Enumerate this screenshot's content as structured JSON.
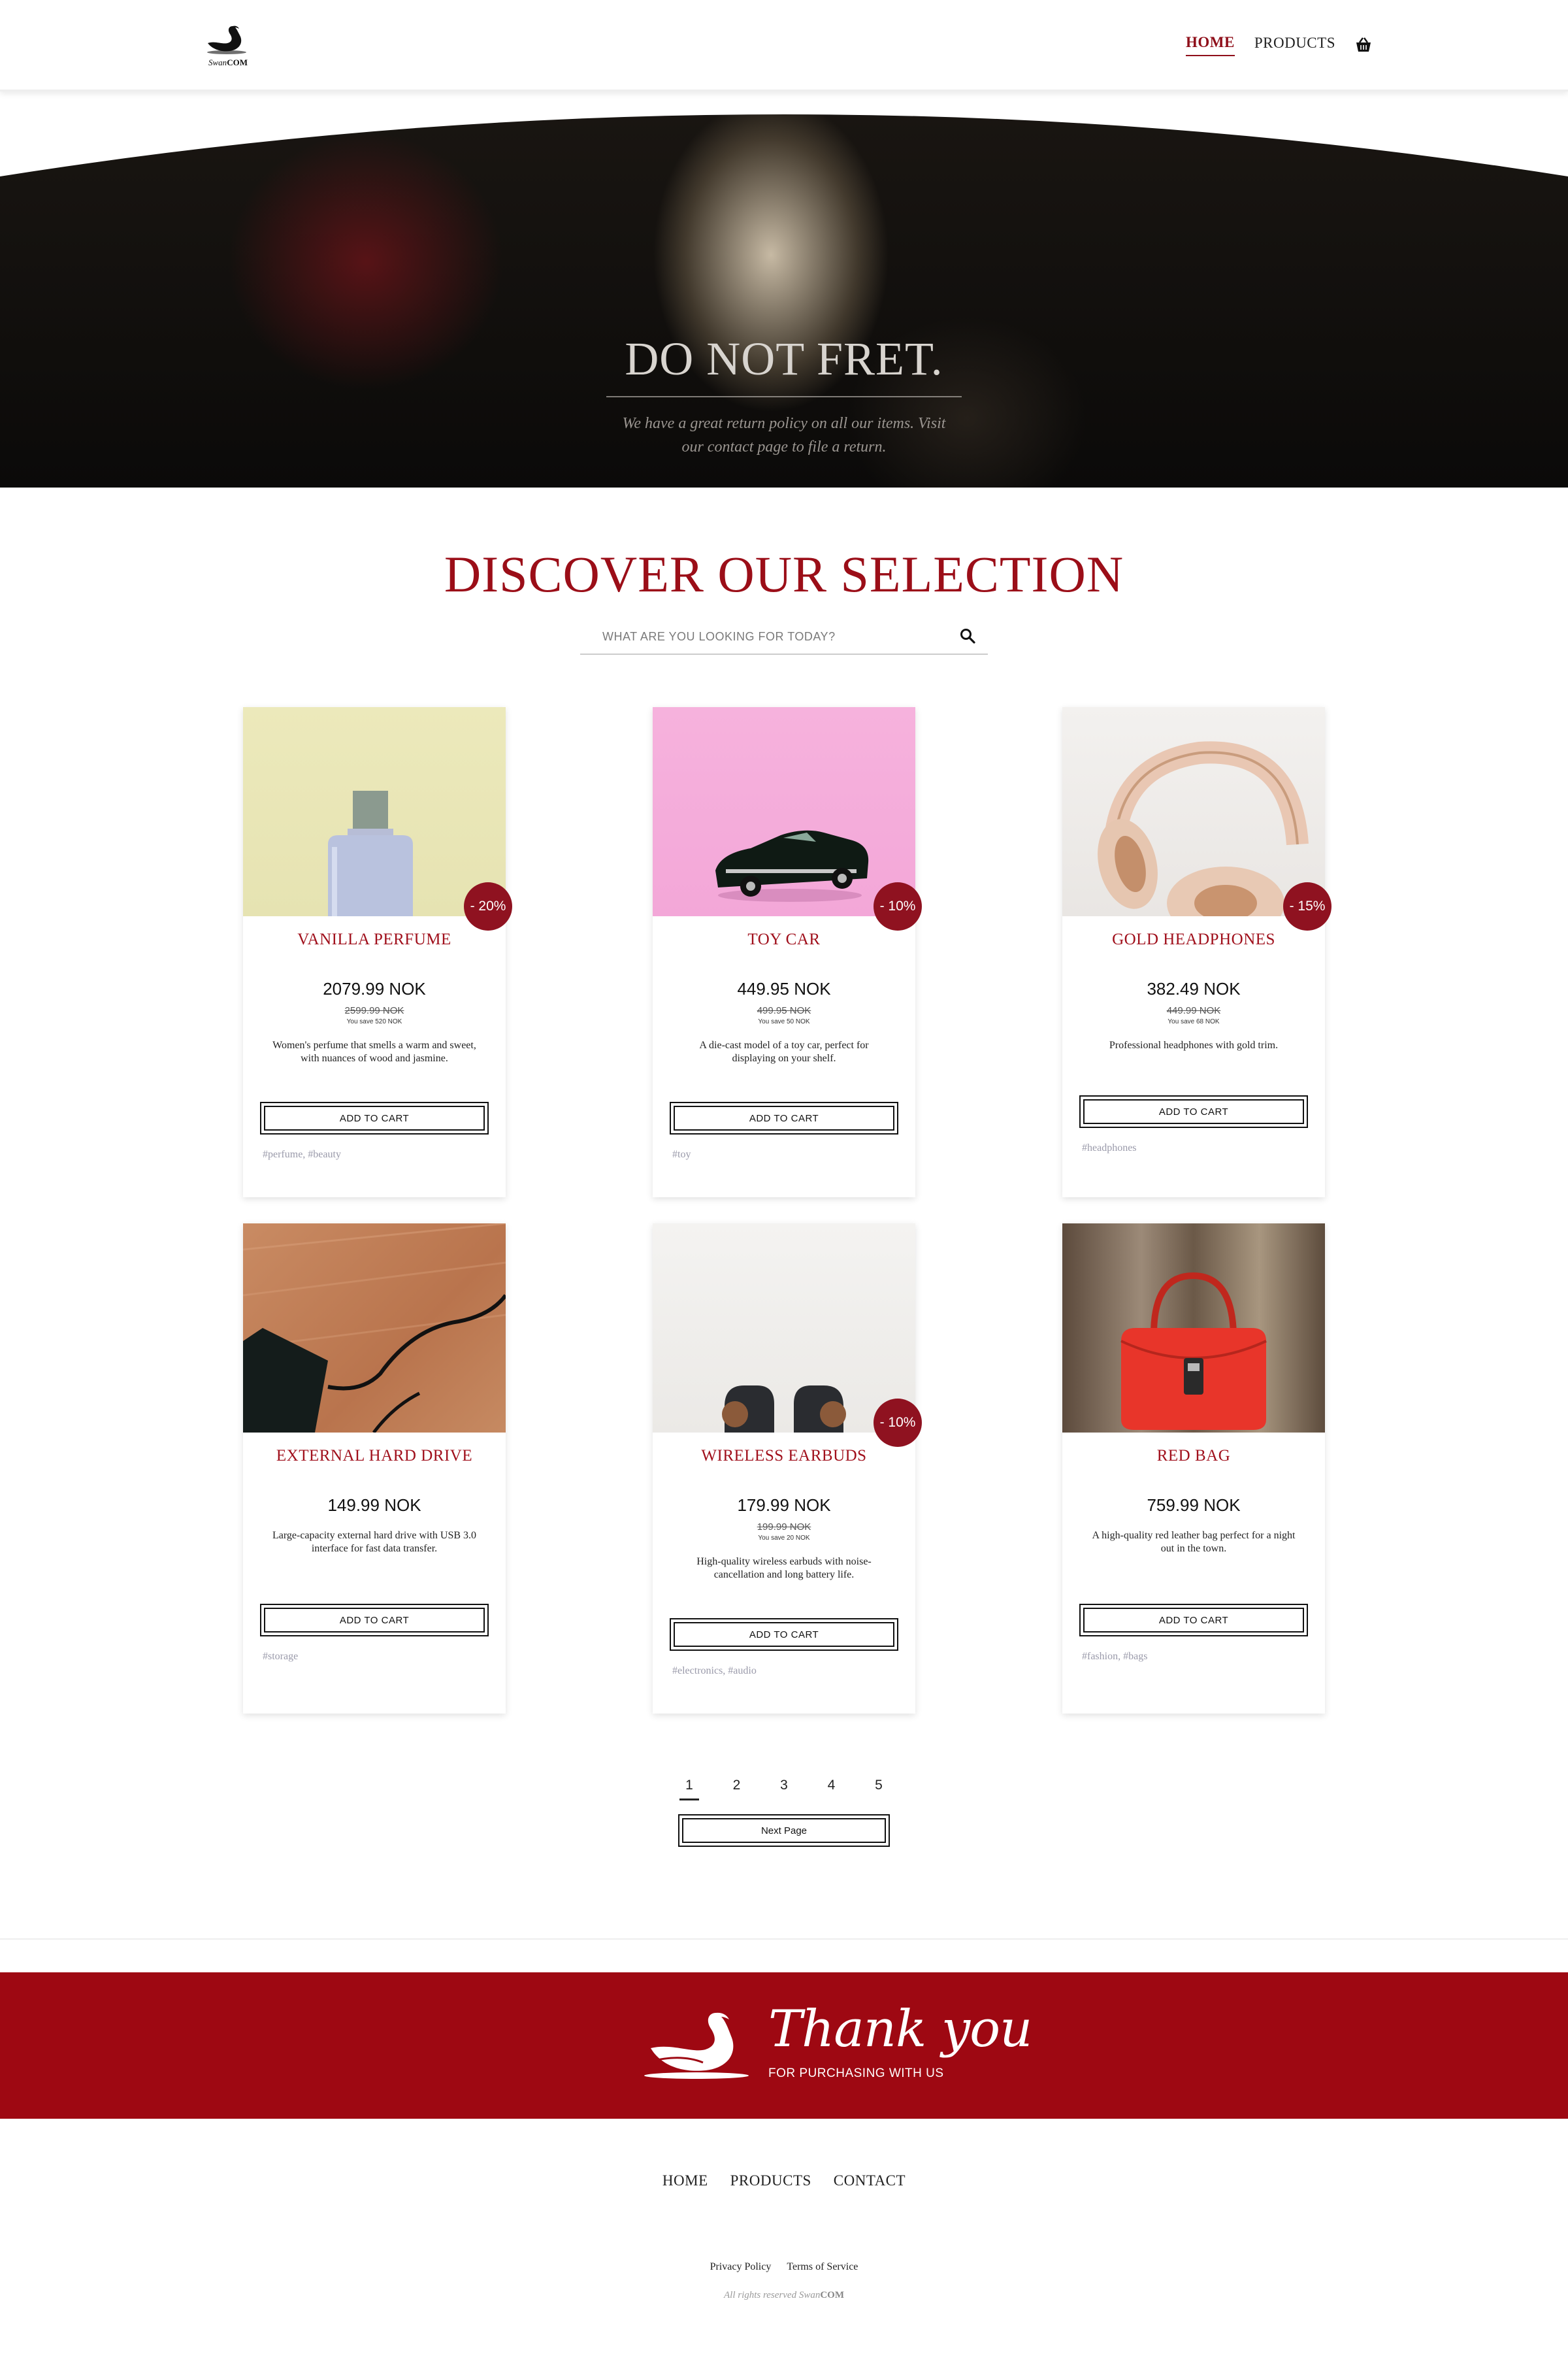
{
  "header": {
    "brand_script": "Swan",
    "brand_suffix": "COM",
    "nav": [
      {
        "label": "HOME",
        "active": true
      },
      {
        "label": "PRODUCTS",
        "active": false
      }
    ],
    "cart_icon": "basket-icon"
  },
  "hero": {
    "title": "DO NOT FRET.",
    "subtitle": "We have a great return policy on all our items. Visit our contact page to file a return."
  },
  "discover": {
    "title": "DISCOVER OUR SELECTION",
    "search_placeholder": "WHAT ARE YOU LOOKING FOR TODAY?",
    "search_icon": "search-icon"
  },
  "products": [
    {
      "name": "VANILLA PERFUME",
      "price": "2079.99 NOK",
      "old_price": "2599.99 NOK",
      "save": "You save 520 NOK",
      "discount": "- 20%",
      "description": "Women's perfume that smells a warm and sweet, with nuances of wood and jasmine.",
      "button": "ADD TO CART",
      "tags": "#perfume, #beauty"
    },
    {
      "name": "TOY CAR",
      "price": "449.95 NOK",
      "old_price": "499.95 NOK",
      "save": "You save 50 NOK",
      "discount": "- 10%",
      "description": "A die-cast model of a toy car, perfect for displaying on your shelf.",
      "button": "ADD TO CART",
      "tags": "#toy"
    },
    {
      "name": "GOLD HEADPHONES",
      "price": "382.49 NOK",
      "old_price": "449.99 NOK",
      "save": "You save 68 NOK",
      "discount": "- 15%",
      "description": "Professional headphones with gold trim.",
      "button": "ADD TO CART",
      "tags": "#headphones"
    },
    {
      "name": "EXTERNAL HARD DRIVE",
      "price": "149.99 NOK",
      "old_price": "",
      "save": "",
      "discount": "",
      "description": "Large-capacity external hard drive with USB 3.0 interface for fast data transfer.",
      "button": "ADD TO CART",
      "tags": "#storage"
    },
    {
      "name": "WIRELESS EARBUDS",
      "price": "179.99 NOK",
      "old_price": "199.99 NOK",
      "save": "You save 20 NOK",
      "discount": "- 10%",
      "description": "High-quality wireless earbuds with noise-cancellation and long battery life.",
      "button": "ADD TO CART",
      "tags": "#electronics, #audio"
    },
    {
      "name": "RED BAG",
      "price": "759.99 NOK",
      "old_price": "",
      "save": "",
      "discount": "",
      "description": "A high-quality red leather bag perfect for a night out in the town.",
      "button": "ADD TO CART",
      "tags": "#fashion, #bags"
    }
  ],
  "pagination": {
    "pages": [
      "1",
      "2",
      "3",
      "4",
      "5"
    ],
    "current": "1",
    "next_label": "Next Page"
  },
  "banner": {
    "thanks": "Thank you",
    "sub": "FOR PURCHASING WITH US"
  },
  "footer": {
    "nav": [
      "HOME",
      "PRODUCTS",
      "CONTACT"
    ],
    "legal": [
      "Privacy Policy",
      "Terms of Service"
    ],
    "rights": "All rights reserved",
    "rights_brand_script": "Swan",
    "rights_brand_suffix": "COM"
  },
  "colors": {
    "accent": "#9e0812",
    "discount_badge": "#8f1220",
    "hero_text": "#d8d4cf"
  }
}
